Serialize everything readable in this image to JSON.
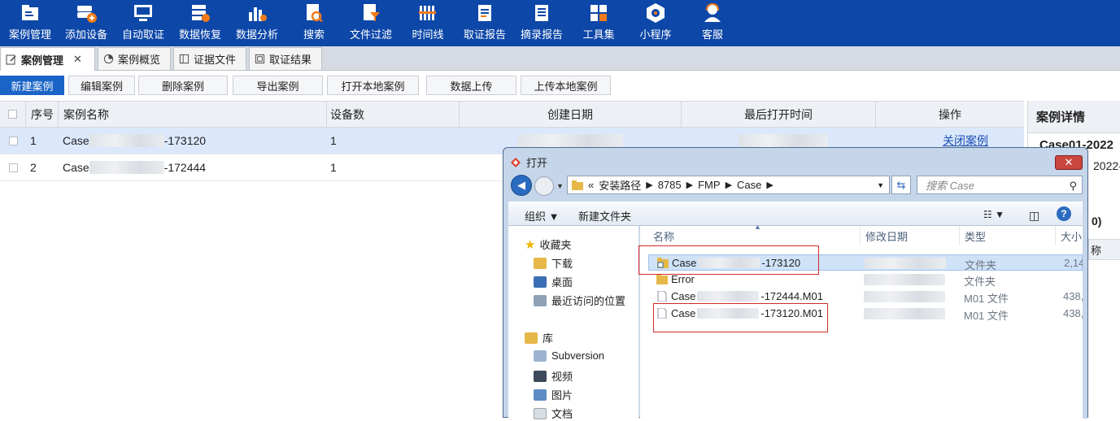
{
  "toolbar": {
    "items": [
      {
        "label": "案例管理",
        "icon": "case-folder-icon"
      },
      {
        "label": "添加设备",
        "icon": "add-device-icon"
      },
      {
        "label": "自动取证",
        "icon": "auto-screen-icon"
      },
      {
        "label": "数据恢复",
        "icon": "recover-icon"
      },
      {
        "label": "数据分析",
        "icon": "analysis-chart-icon"
      },
      {
        "label": "搜索",
        "icon": "search-doc-icon"
      },
      {
        "label": "文件过滤",
        "icon": "filter-icon"
      },
      {
        "label": "时间线",
        "icon": "timeline-icon"
      },
      {
        "label": "取证报告",
        "icon": "report-icon"
      },
      {
        "label": "摘录报告",
        "icon": "excerpt-icon"
      },
      {
        "label": "工具集",
        "icon": "toolset-grid-icon"
      },
      {
        "label": "小程序",
        "icon": "miniprogram-icon"
      },
      {
        "label": "客服",
        "icon": "support-agent-icon"
      }
    ]
  },
  "tabs": [
    {
      "label": "案例管理",
      "close": "✕"
    },
    {
      "label": "案例概览"
    },
    {
      "label": "证据文件"
    },
    {
      "label": "取证结果"
    }
  ],
  "actions": {
    "new_case": "新建案例",
    "edit_case": "编辑案例",
    "delete_case": "删除案例",
    "export_case": "导出案例",
    "open_local_case": "打开本地案例",
    "upload_data": "数据上传",
    "upload_local_case": "上传本地案例"
  },
  "case_table": {
    "headers": {
      "index": "序号",
      "name": "案例名称",
      "devices": "设备数",
      "created": "创建日期",
      "last_opened": "最后打开时间",
      "ops": "操作"
    },
    "rows": [
      {
        "index": "1",
        "name_prefix": "Case",
        "name_suffix": "-173120",
        "devices": "1",
        "op": "关闭案例"
      },
      {
        "index": "2",
        "name_prefix": "Case",
        "name_suffix": "-172444",
        "devices": "1",
        "op": ""
      }
    ]
  },
  "detail": {
    "title": "案例详情",
    "case_name": "Case01-2022",
    "date": "2022-",
    "count": "0)",
    "column": "称"
  },
  "dialog": {
    "title": "打开",
    "close": "✕",
    "path": [
      "«",
      "安装路径",
      "8785",
      "FMP",
      "Case"
    ],
    "search_placeholder": "搜索 Case",
    "organize": "组织 ▼",
    "new_folder": "新建文件夹",
    "nav": [
      {
        "label": "收藏夹",
        "color": "#f0b400"
      },
      {
        "label": "下载",
        "color": "#e6b84a"
      },
      {
        "label": "桌面",
        "color": "#3a6fb5"
      },
      {
        "label": "最近访问的位置",
        "color": "#8fa1b6"
      },
      {
        "label": "库",
        "color": "#e6b84a"
      },
      {
        "label": "Subversion",
        "color": "#9cb4cf"
      },
      {
        "label": "视频",
        "color": "#3d4a5a"
      },
      {
        "label": "图片",
        "color": "#5e8cc4"
      },
      {
        "label": "文档",
        "color": "#d8dde4"
      }
    ],
    "columns": {
      "name": "名称",
      "modified": "修改日期",
      "type": "类型",
      "size": "大小"
    },
    "files": [
      {
        "prefix": "Case",
        "suffix": "-173120",
        "type": "文件夹",
        "size": "2,14",
        "icon": "folder-shortcut-icon",
        "selected": true
      },
      {
        "prefix": "Error",
        "suffix": "",
        "type": "文件夹",
        "size": "",
        "icon": "folder-icon",
        "selected": false
      },
      {
        "prefix": "Case",
        "suffix": "-172444.M01",
        "type": "M01 文件",
        "size": "438,",
        "icon": "file-icon",
        "selected": false
      },
      {
        "prefix": "Case",
        "suffix": "-173120.M01",
        "type": "M01 文件",
        "size": "438,",
        "icon": "file-icon",
        "selected": false
      }
    ]
  },
  "colors": {
    "toolbar_bg": "#0d47a8",
    "primary_button": "#1a64c8",
    "selected_row": "#dbe8fb",
    "highlight_box": "#d22b2b"
  }
}
